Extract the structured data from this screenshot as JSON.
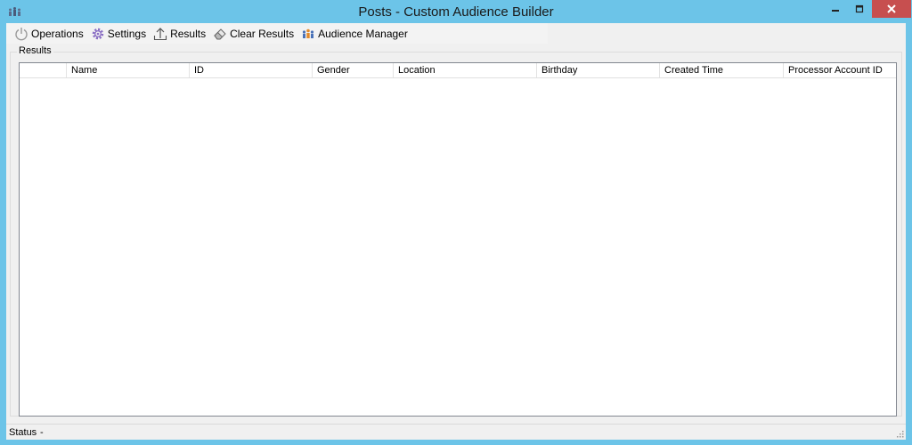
{
  "window": {
    "title": "Posts - Custom Audience Builder",
    "controls": [
      "minimize",
      "maximize",
      "close"
    ]
  },
  "toolbar": {
    "items": [
      {
        "label": "Operations",
        "icon": "power-icon"
      },
      {
        "label": "Settings",
        "icon": "gear-icon"
      },
      {
        "label": "Results",
        "icon": "upload-arrow-icon"
      },
      {
        "label": "Clear Results",
        "icon": "eraser-icon"
      },
      {
        "label": "Audience Manager",
        "icon": "people-icon"
      }
    ]
  },
  "results": {
    "group_label": "Results",
    "columns": [
      "",
      "Name",
      "ID",
      "Gender",
      "Location",
      "Birthday",
      "Created Time",
      "Processor Account ID"
    ],
    "rows": []
  },
  "status": {
    "label": "Status",
    "value": "-"
  },
  "colors": {
    "frame": "#6cc4e8",
    "close_button": "#c74f4f",
    "client_bg": "#f0f0f0"
  }
}
